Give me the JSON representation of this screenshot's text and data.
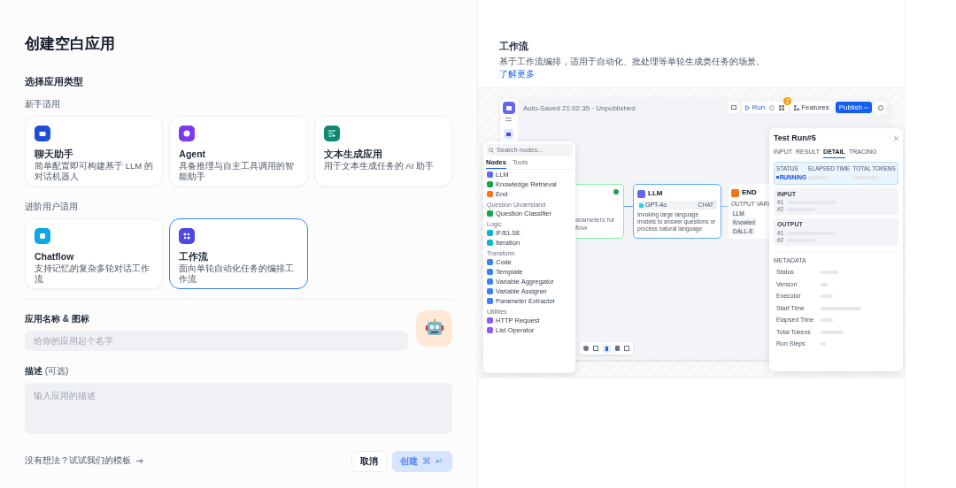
{
  "title": "创建空白应用",
  "section_title": "选择应用类型",
  "groups": [
    {
      "label": "新手适用",
      "cards": [
        {
          "kind": "chatbot",
          "title": "聊天助手",
          "description": "简单配置即可构建基于 LLM 的对话机器人",
          "selected": false
        },
        {
          "kind": "agent",
          "title": "Agent",
          "description": "具备推理与自主工具调用的智能助手",
          "selected": false
        },
        {
          "kind": "completion",
          "title": "文本生成应用",
          "description": "用于文本生成任务的 AI 助手",
          "selected": false
        }
      ]
    },
    {
      "label": "进阶用户适用",
      "cards": [
        {
          "kind": "chatflow",
          "title": "Chatflow",
          "description": "支持记忆的复杂多轮对话工作流",
          "selected": false
        },
        {
          "kind": "workflow",
          "title": "工作流",
          "description": "面向单轮自动化任务的编排工作流",
          "selected": true
        }
      ]
    }
  ],
  "name_field": {
    "label": "应用名称 & 图标",
    "placeholder": "给你的应用起个名字"
  },
  "description_field": {
    "label": "描述",
    "optional": "(可选)",
    "placeholder": "输入应用的描述"
  },
  "template_link": "没有想法？试试我们的模板",
  "buttons": [
    {
      "kind": "cancel",
      "label": "取消",
      "disabled": false
    },
    {
      "kind": "create",
      "label": "创建",
      "shortcut": [
        "⌘",
        "↵"
      ],
      "disabled": true
    }
  ],
  "preview": {
    "title": "工作流",
    "description": "基于工作流编排，适用于自动化、批处理等单轮生成类任务的场景。",
    "link": "了解更多",
    "editor": {
      "autosave": "Auto-Saved 21:02:35 · Unpublished",
      "run": "Run",
      "badge": "2",
      "features": "Features",
      "publish": "Publish",
      "search_placeholder": "Search nodes...",
      "tabs": [
        {
          "label": "Nodes",
          "selected": true
        },
        {
          "label": "Tools",
          "selected": false
        }
      ],
      "node_groups": [
        {
          "items": [
            {
              "label": "LLM",
              "color": "#6366f1"
            },
            {
              "label": "Knowledge Retrieval",
              "color": "#16a34a"
            },
            {
              "label": "End",
              "color": "#f97316"
            }
          ]
        },
        {
          "label": "Question Understand",
          "items": [
            {
              "label": "Question Classifier",
              "color": "#16a34a"
            }
          ]
        },
        {
          "label": "Logic",
          "items": [
            {
              "label": "IF/ELSE",
              "color": "#06b6d4"
            },
            {
              "label": "Iteration",
              "color": "#06b6d4"
            }
          ]
        },
        {
          "label": "Transform",
          "items": [
            {
              "label": "Code",
              "color": "#3b82f6"
            },
            {
              "label": "Template",
              "color": "#3b82f6"
            },
            {
              "label": "Variable Aggregator",
              "color": "#3b82f6"
            },
            {
              "label": "Variable Assigner",
              "color": "#3b82f6"
            },
            {
              "label": "Parameter Extractor",
              "color": "#3b82f6"
            }
          ]
        },
        {
          "label": "Utilities",
          "items": [
            {
              "label": "HTTP Request",
              "color": "#8b5cf6"
            },
            {
              "label": "List Operator",
              "color": "#8b5cf6"
            }
          ]
        }
      ],
      "start_node": {
        "description_lines": [
          "arameters for",
          "flow"
        ]
      },
      "llm_node": {
        "title": "LLM",
        "model": "GPT-4o",
        "mode": "CHAT",
        "description": "Invoking large language models to answer questions or process natural language"
      },
      "end_node": {
        "title": "END",
        "output_label": "OUTPUT VARI",
        "variables": [
          "LLM",
          "Knowled",
          "DALL-E"
        ]
      },
      "run_panel": {
        "title": "Test Run#5",
        "tabs": [
          {
            "label": "INPUT",
            "selected": false
          },
          {
            "label": "RESULT",
            "selected": false
          },
          {
            "label": "DETAIL",
            "selected": true
          },
          {
            "label": "TRACING",
            "selected": false
          }
        ],
        "status_label": "STATUS",
        "status": "RUNNING",
        "elapsed_label": "ELAPSED TIME",
        "tokens_label": "TOTAL TOKENS",
        "sections": [
          {
            "title": "INPUT",
            "rows": [
              "#1",
              "#2"
            ]
          },
          {
            "title": "OUTPUT",
            "rows": [
              "#1",
              "#2"
            ]
          }
        ],
        "metadata_title": "METADATA",
        "metadata": [
          "Status",
          "Version",
          "Executor",
          "Start Time",
          "Elapsed Time",
          "Total Tokens",
          "Run Steps"
        ]
      }
    }
  }
}
